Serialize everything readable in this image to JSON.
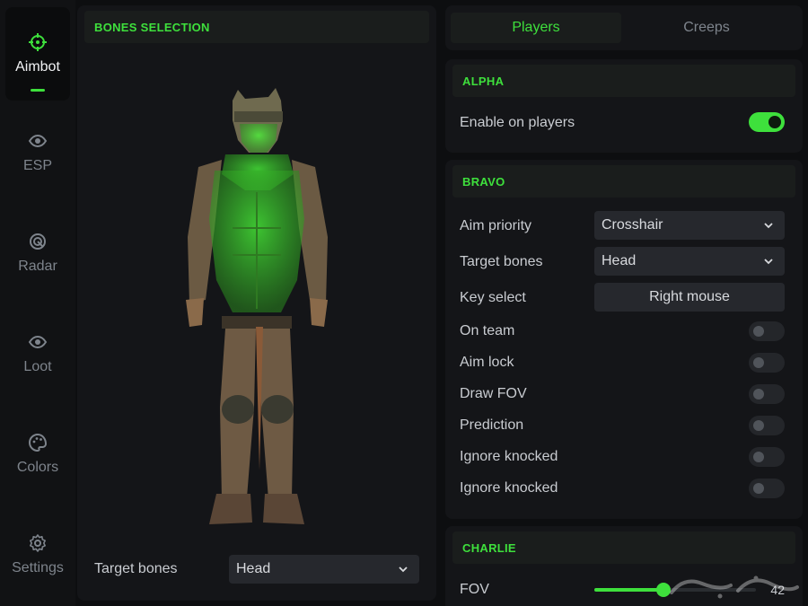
{
  "sidebar": {
    "items": [
      {
        "label": "Aimbot",
        "icon": "crosshair-icon",
        "active": true
      },
      {
        "label": "ESP",
        "icon": "eye-icon"
      },
      {
        "label": "Radar",
        "icon": "radar-icon"
      },
      {
        "label": "Loot",
        "icon": "eye-icon"
      },
      {
        "label": "Colors",
        "icon": "palette-icon"
      },
      {
        "label": "Settings",
        "icon": "gear-icon"
      }
    ]
  },
  "bones_panel": {
    "title": "BONES SELECTION",
    "target_bones_label": "Target bones",
    "target_bones_value": "Head"
  },
  "tabs": [
    {
      "label": "Players",
      "active": true
    },
    {
      "label": "Creeps",
      "active": false
    }
  ],
  "alpha": {
    "title": "ALPHA",
    "enable_label": "Enable on players",
    "enable_on": true
  },
  "bravo": {
    "title": "BRAVO",
    "aim_priority_label": "Aim priority",
    "aim_priority_value": "Crosshair",
    "target_bones_label": "Target bones",
    "target_bones_value": "Head",
    "key_select_label": "Key select",
    "key_select_value": "Right mouse",
    "toggles": [
      {
        "label": "On team",
        "on": false
      },
      {
        "label": "Aim lock",
        "on": false
      },
      {
        "label": "Draw FOV",
        "on": false
      },
      {
        "label": "Prediction",
        "on": false
      },
      {
        "label": "Ignore knocked",
        "on": false
      },
      {
        "label": "Ignore knocked",
        "on": false
      }
    ]
  },
  "charlie": {
    "title": "CHARLIE",
    "fov_label": "FOV",
    "fov_value": "42",
    "fov_fraction": 0.43
  },
  "colors": {
    "accent": "#3ee03c",
    "background": "#0d0e10",
    "panel": "#141518"
  }
}
